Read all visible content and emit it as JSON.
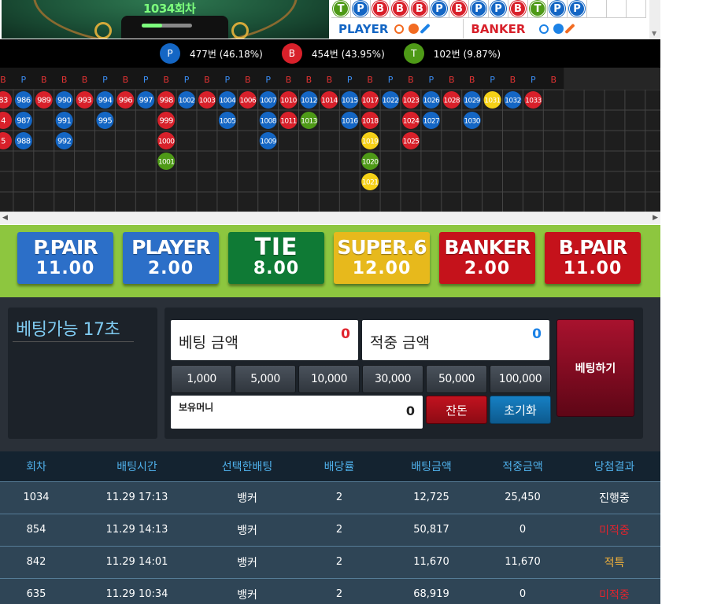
{
  "colors": {
    "player": "#1466c4",
    "banker": "#d8202a",
    "tie": "#4e9a17",
    "super6": "#f5d117"
  },
  "table": {
    "round_label": "1034회차"
  },
  "bead_top": [
    "T",
    "P",
    "B",
    "B",
    "B",
    "P",
    "B",
    "P",
    "P",
    "B",
    "T",
    "P",
    "P"
  ],
  "prediction": {
    "player_label": "PLAYER",
    "banker_label": "BANKER"
  },
  "stats": [
    {
      "sym": "P",
      "text": "477번 (46.18%)",
      "color": "#1466c4"
    },
    {
      "sym": "B",
      "text": "454번 (43.95%)",
      "color": "#d8202a"
    },
    {
      "sym": "T",
      "text": "102번 (9.87%)",
      "color": "#4e9a17"
    }
  ],
  "road_headers": [
    "B",
    "P",
    "B",
    "B",
    "B",
    "P",
    "B",
    "P",
    "B",
    "P",
    "B",
    "P",
    "B",
    "P",
    "B",
    "B",
    "B",
    "P",
    "B",
    "P",
    "B",
    "P",
    "B",
    "B",
    "P",
    "B",
    "P",
    "B"
  ],
  "road_columns": [
    {
      "col": 0,
      "balls": [
        {
          "n": "83",
          "c": "B"
        },
        {
          "n": "4",
          "c": "B"
        },
        {
          "n": "5",
          "c": "B"
        }
      ]
    },
    {
      "col": 1,
      "balls": [
        {
          "n": "986",
          "c": "P"
        },
        {
          "n": "987",
          "c": "P"
        },
        {
          "n": "988",
          "c": "P"
        }
      ]
    },
    {
      "col": 2,
      "balls": [
        {
          "n": "989",
          "c": "B"
        }
      ]
    },
    {
      "col": 3,
      "balls": [
        {
          "n": "990",
          "c": "P"
        },
        {
          "n": "991",
          "c": "P"
        },
        {
          "n": "992",
          "c": "P"
        }
      ]
    },
    {
      "col": 4,
      "balls": [
        {
          "n": "993",
          "c": "B"
        }
      ]
    },
    {
      "col": 5,
      "balls": [
        {
          "n": "994",
          "c": "P"
        },
        {
          "n": "995",
          "c": "P"
        }
      ]
    },
    {
      "col": 6,
      "balls": [
        {
          "n": "996",
          "c": "B"
        }
      ]
    },
    {
      "col": 7,
      "balls": [
        {
          "n": "997",
          "c": "P"
        }
      ]
    },
    {
      "col": 8,
      "balls": [
        {
          "n": "998",
          "c": "B"
        },
        {
          "n": "999",
          "c": "B"
        },
        {
          "n": "1000",
          "c": "B"
        },
        {
          "n": "1001",
          "c": "T"
        }
      ]
    },
    {
      "col": 9,
      "balls": [
        {
          "n": "1002",
          "c": "P"
        }
      ]
    },
    {
      "col": 10,
      "balls": [
        {
          "n": "1003",
          "c": "B"
        }
      ]
    },
    {
      "col": 11,
      "balls": [
        {
          "n": "1004",
          "c": "P"
        },
        {
          "n": "1005",
          "c": "P"
        }
      ]
    },
    {
      "col": 12,
      "balls": [
        {
          "n": "1006",
          "c": "B"
        }
      ]
    },
    {
      "col": 13,
      "balls": [
        {
          "n": "1007",
          "c": "P"
        },
        {
          "n": "1008",
          "c": "P"
        },
        {
          "n": "1009",
          "c": "P"
        }
      ]
    },
    {
      "col": 14,
      "balls": [
        {
          "n": "1010",
          "c": "B"
        },
        {
          "n": "1011",
          "c": "B"
        }
      ]
    },
    {
      "col": 15,
      "balls": [
        {
          "n": "1012",
          "c": "P"
        },
        {
          "n": "1013",
          "c": "T"
        }
      ]
    },
    {
      "col": 16,
      "balls": [
        {
          "n": "1014",
          "c": "B"
        }
      ]
    },
    {
      "col": 17,
      "balls": [
        {
          "n": "1015",
          "c": "P"
        },
        {
          "n": "1016",
          "c": "P"
        }
      ]
    },
    {
      "col": 18,
      "balls": [
        {
          "n": "1017",
          "c": "B"
        },
        {
          "n": "1018",
          "c": "B"
        },
        {
          "n": "1019",
          "c": "S"
        },
        {
          "n": "1020",
          "c": "T"
        },
        {
          "n": "1021",
          "c": "S"
        }
      ]
    },
    {
      "col": 19,
      "balls": [
        {
          "n": "1022",
          "c": "P"
        }
      ]
    },
    {
      "col": 20,
      "balls": [
        {
          "n": "1023",
          "c": "B"
        },
        {
          "n": "1024",
          "c": "B"
        },
        {
          "n": "1025",
          "c": "B"
        }
      ]
    },
    {
      "col": 21,
      "balls": [
        {
          "n": "1026",
          "c": "P"
        },
        {
          "n": "1027",
          "c": "P"
        }
      ]
    },
    {
      "col": 22,
      "balls": [
        {
          "n": "1028",
          "c": "B"
        }
      ]
    },
    {
      "col": 23,
      "balls": [
        {
          "n": "1029",
          "c": "P"
        },
        {
          "n": "1030",
          "c": "P"
        }
      ]
    },
    {
      "col": 24,
      "balls": [
        {
          "n": "1031",
          "c": "S"
        }
      ]
    },
    {
      "col": 25,
      "balls": [
        {
          "n": "1032",
          "c": "P"
        }
      ]
    },
    {
      "col": 26,
      "balls": [
        {
          "n": "1033",
          "c": "B"
        }
      ]
    }
  ],
  "bets": [
    {
      "name": "P.PAIR",
      "odds": "11.00",
      "bg": "#2c6fc8"
    },
    {
      "name": "PLAYER",
      "odds": "2.00",
      "bg": "#2c6fc8"
    },
    {
      "name": "TIE",
      "odds": "8.00",
      "bg": "#0f7a35"
    },
    {
      "name": "SUPER.6",
      "odds": "12.00",
      "bg": "#e7b91c"
    },
    {
      "name": "BANKER",
      "odds": "2.00",
      "bg": "#c5121b"
    },
    {
      "name": "B.PAIR",
      "odds": "11.00",
      "bg": "#c5121b"
    }
  ],
  "timer": {
    "text": "베팅가능 17초"
  },
  "bet_amount": {
    "label": "베팅 금액",
    "value": "0"
  },
  "win_amount": {
    "label": "적중 금액",
    "value": "0"
  },
  "chips": [
    "1,000",
    "5,000",
    "10,000",
    "30,000",
    "50,000",
    "100,000"
  ],
  "money": {
    "label": "보유머니",
    "value": "0"
  },
  "buttons": {
    "rest": "잔돈",
    "reset": "초기화",
    "submit": "베팅하기"
  },
  "history": {
    "headers": [
      "회차",
      "배팅시간",
      "선택한배팅",
      "배당률",
      "배팅금액",
      "적중금액",
      "당첨결과"
    ],
    "rows": [
      {
        "cells": [
          "1034",
          "11.29 17:13",
          "뱅커",
          "2",
          "12,725",
          "25,450",
          "진행중"
        ],
        "result_color": "#ffffff"
      },
      {
        "cells": [
          "854",
          "11.29 14:13",
          "뱅커",
          "2",
          "50,817",
          "0",
          "미적중"
        ],
        "result_color": "#e0242e"
      },
      {
        "cells": [
          "842",
          "11.29 14:01",
          "뱅커",
          "2",
          "11,670",
          "11,670",
          "적특"
        ],
        "result_color": "#f4b23a"
      },
      {
        "cells": [
          "635",
          "11.29 10:34",
          "뱅커",
          "2",
          "68,919",
          "0",
          "미적중"
        ],
        "result_color": "#e0242e"
      }
    ]
  }
}
